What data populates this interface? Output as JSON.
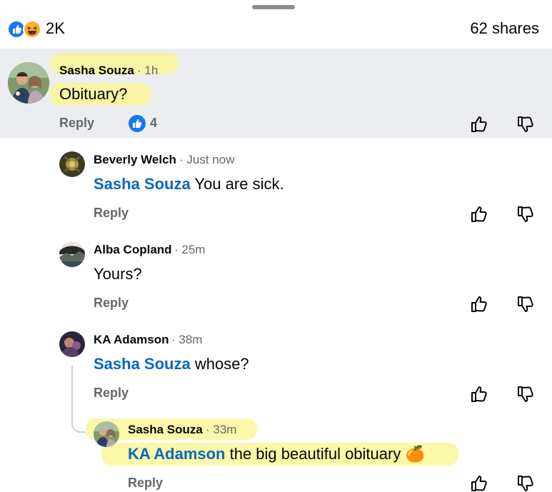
{
  "summary": {
    "reaction_count": "2K",
    "shares": "62 shares",
    "reaction_icons": [
      "like-icon",
      "haha-icon"
    ]
  },
  "colors": {
    "mention": "#0a66c2",
    "highlighted_comment_bg": "#ebedf0",
    "like_blue": "#1877f2"
  },
  "comments": [
    {
      "author": "Sasha Souza",
      "time": "· 1h",
      "text": "Obituary?",
      "reply_label": "Reply",
      "reaction_count": "4"
    },
    {
      "author": "Beverly Welch",
      "time": "· Just now",
      "mention": "Sasha Souza",
      "text": " You are sick.",
      "reply_label": "Reply"
    },
    {
      "author": "Alba Copland",
      "time": "· 25m",
      "text": "Yours?",
      "reply_label": "Reply"
    },
    {
      "author": "KA Adamson",
      "time": "· 38m",
      "mention": "Sasha Souza",
      "text": " whose?",
      "reply_label": "Reply"
    },
    {
      "author": "Sasha Souza",
      "time": "· 33m",
      "mention": "KA Adamson",
      "text": " the big beautiful obituary",
      "emoji": "🍊",
      "reply_label": "Reply"
    }
  ]
}
